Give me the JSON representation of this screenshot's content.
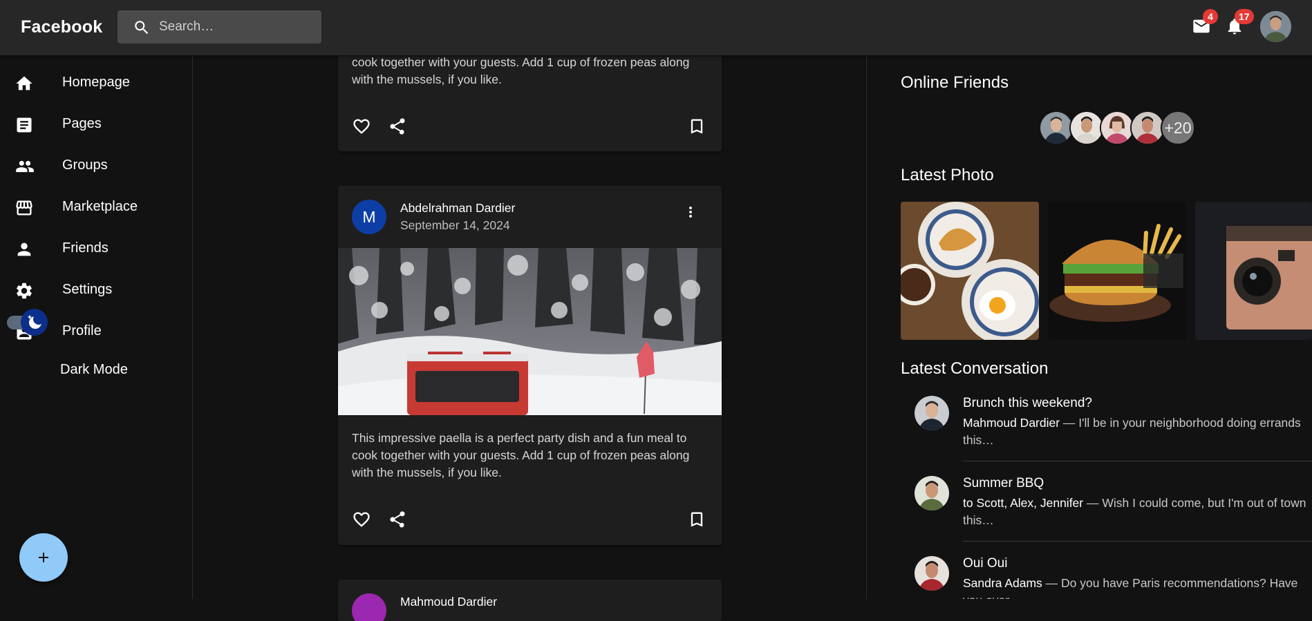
{
  "header": {
    "brand": "Facebook",
    "search_placeholder": "Search…",
    "mail_badge": "4",
    "notif_badge": "17"
  },
  "sidebar": {
    "items": [
      {
        "label": "Homepage",
        "icon": "home-icon"
      },
      {
        "label": "Pages",
        "icon": "article-icon"
      },
      {
        "label": "Groups",
        "icon": "groups-icon"
      },
      {
        "label": "Marketplace",
        "icon": "storefront-icon"
      },
      {
        "label": "Friends",
        "icon": "person-icon"
      },
      {
        "label": "Settings",
        "icon": "gear-icon"
      },
      {
        "label": "Profile",
        "icon": "account-box-icon"
      }
    ],
    "dark_mode_label": "Dark Mode",
    "dark_mode_on": true
  },
  "feed": {
    "posts": [
      {
        "text_line1": "cook together with your guests. Add 1 cup of frozen peas along",
        "text_line2": "with the mussels, if you like."
      },
      {
        "avatar_letter": "M",
        "author": "Abdelrahman Dardier",
        "date": "September 14, 2024",
        "text_line1": "This impressive paella is a perfect party dish and a fun meal to",
        "text_line2": "cook together with your guests. Add 1 cup of frozen peas along",
        "text_line3": "with the mussels, if you like."
      },
      {
        "author": "Mahmoud Dardier"
      }
    ]
  },
  "right": {
    "online_title": "Online Friends",
    "online_more": "+20",
    "photos_title": "Latest Photo",
    "conversation_title": "Latest Conversation",
    "conversations": [
      {
        "title": "Brunch this weekend?",
        "who": "Mahmoud Dardier",
        "snippet": " — I'll be in your neighborhood doing errands this…"
      },
      {
        "title": "Summer BBQ",
        "who": "to Scott, Alex, Jennifer",
        "snippet": " — Wish I could come, but I'm out of town this…"
      },
      {
        "title": "Oui Oui",
        "who": "Sandra Adams",
        "snippet": " — Do you have Paris recommendations? Have you ever…"
      }
    ]
  },
  "colors": {
    "background": "#121212",
    "surface": "#1e1e1e",
    "appbar": "#272727",
    "badge": "#e53935",
    "fab": "#90caf9",
    "avatar_blue": "#0d3ea6"
  }
}
